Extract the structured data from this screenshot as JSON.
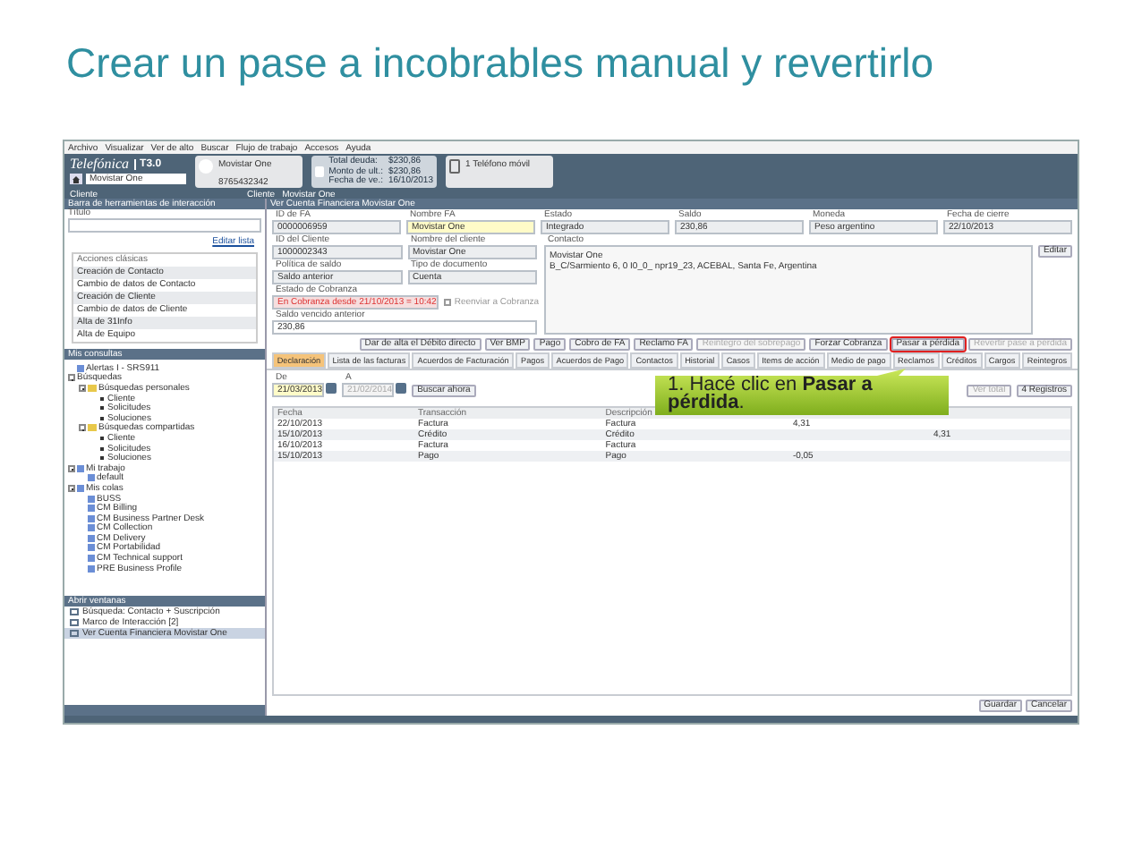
{
  "slide_title": "Crear un pase a incobrables manual y revertirlo",
  "app": {
    "menu": [
      "Archivo",
      "Visualizar",
      "Ver de alto",
      "Buscar",
      "Flujo de trabajo",
      "Accesos",
      "Ayuda"
    ],
    "header": {
      "logo": "Telefónica",
      "version": "T3.0",
      "account_combo": "Movistar One",
      "customer_name": "Movistar One",
      "customer_id": "8765432342",
      "customer_label": "Cliente",
      "totals": [
        {
          "label": "Total deuda:",
          "value": "$230,86"
        },
        {
          "label": "Monto de ult.:",
          "value": "$230,86"
        },
        {
          "label": "Fecha de ve.:",
          "value": "16/10/2013"
        }
      ],
      "phone_card": "1 Teléfono móvil",
      "bottom_label": "Cliente",
      "bottom_value": "Movistar One"
    },
    "toolbar_panel": {
      "title": "Barra de herramientas de interacción",
      "title_label": "Título",
      "edit_link": "Editar lista",
      "items": [
        {
          "label": "Acciones clásicas",
          "kind": "header"
        },
        {
          "label": "Creación de Contacto",
          "kind": "item"
        },
        {
          "label": "Cambio de datos de Contacto",
          "kind": "item"
        },
        {
          "label": "Creación de Cliente",
          "kind": "item"
        },
        {
          "label": "Cambio de datos de Cliente",
          "kind": "item"
        },
        {
          "label": "Alta de 31Info",
          "kind": "item"
        },
        {
          "label": "Alta de Equipo",
          "kind": "item"
        }
      ]
    },
    "queries_panel": {
      "title": "Mis consultas",
      "tree": [
        {
          "label": "Alertas I - SRS911",
          "kind": "query"
        },
        {
          "label": "Búsquedas",
          "kind": "plain",
          "expanded": true,
          "children": [
            {
              "label": "Búsquedas personales",
              "kind": "folder",
              "expanded": true,
              "children": [
                {
                  "label": "Cliente",
                  "kind": "leaf"
                },
                {
                  "label": "Solicitudes",
                  "kind": "leaf"
                },
                {
                  "label": "Soluciones",
                  "kind": "leaf"
                }
              ]
            },
            {
              "label": "Búsquedas compartidas",
              "kind": "folder",
              "expanded": true,
              "children": [
                {
                  "label": "Cliente",
                  "kind": "leaf"
                },
                {
                  "label": "Solicitudes",
                  "kind": "leaf"
                },
                {
                  "label": "Soluciones",
                  "kind": "leaf"
                }
              ]
            }
          ]
        },
        {
          "label": "Mi trabajo",
          "kind": "query",
          "expanded": true,
          "children": [
            {
              "label": "default",
              "kind": "query"
            }
          ]
        },
        {
          "label": "Mis colas",
          "kind": "query",
          "expanded": true,
          "children": [
            {
              "label": "BUSS",
              "kind": "query"
            },
            {
              "label": "CM Billing",
              "kind": "query"
            },
            {
              "label": "CM Business Partner Desk",
              "kind": "query"
            },
            {
              "label": "CM Collection",
              "kind": "query"
            },
            {
              "label": "CM Delivery",
              "kind": "query"
            },
            {
              "label": "CM Portabilidad",
              "kind": "query"
            },
            {
              "label": "CM Technical support",
              "kind": "query"
            },
            {
              "label": "PRE Business Profile",
              "kind": "query"
            }
          ]
        }
      ]
    },
    "windows_panel": {
      "title": "Abrir ventanas",
      "items": [
        {
          "label": "Búsqueda: Contacto + Suscripción",
          "selected": false
        },
        {
          "label": "Marco de Interacción [2]",
          "selected": false
        },
        {
          "label": "Ver Cuenta Financiera Movistar One",
          "selected": true
        }
      ]
    },
    "main": {
      "title": "Ver Cuenta Financiera Movistar One",
      "top_fields": [
        {
          "label": "ID de FA",
          "value": "0000006959",
          "kind": "plain"
        },
        {
          "label": "Nombre FA",
          "value": "Movistar One",
          "kind": "highlight"
        },
        {
          "label": "Estado",
          "value": "Integrado",
          "kind": "plain"
        },
        {
          "label": "Saldo",
          "value": "230,86",
          "kind": "plain"
        },
        {
          "label": "Moneda",
          "value": "Peso argentino",
          "kind": "plain"
        },
        {
          "label": "Fecha de cierre",
          "value": "22/10/2013",
          "kind": "plain"
        }
      ],
      "left_rows": [
        [
          {
            "label": "ID del Cliente",
            "value": "1000002343",
            "kind": "plain"
          },
          {
            "label": "Nombre del cliente",
            "value": "Movistar One",
            "kind": "plain"
          }
        ],
        [
          {
            "label": "Política de saldo",
            "value": "Saldo anterior",
            "kind": "plain"
          },
          {
            "label": "Tipo de documento",
            "value": "Cuenta",
            "kind": "plain"
          }
        ],
        [
          {
            "label": "Estado de Cobranza",
            "value": "En Cobranza desde 21/10/2013 = 10:42",
            "kind": "alert"
          }
        ],
        [
          {
            "label": "Saldo vencido anterior",
            "value": "230,86",
            "kind": "input"
          }
        ]
      ],
      "resend": {
        "label": "Reenviar a Cobranza",
        "checked": false,
        "disabled": true
      },
      "contact": {
        "label": "Contacto",
        "lines": [
          "Movistar One",
          "B_C/Sarmiento 6, 0 I0_0_ npr19_23, ACEBAL, Santa Fe, Argentina"
        ],
        "button": "Editar"
      },
      "actions": [
        {
          "label": "Dar de alta el Débito directo",
          "disabled": false,
          "highlighted": false
        },
        {
          "label": "Ver BMP",
          "disabled": false,
          "highlighted": false
        },
        {
          "label": "Pago",
          "disabled": false,
          "highlighted": false
        },
        {
          "label": "Cobro de FA",
          "disabled": false,
          "highlighted": false
        },
        {
          "label": "Reclamo FA",
          "disabled": false,
          "highlighted": false
        },
        {
          "label": "Reintegro del sobrepago",
          "disabled": true,
          "highlighted": false
        },
        {
          "label": "Forzar Cobranza",
          "disabled": false,
          "highlighted": false
        },
        {
          "label": "Pasar a pérdida",
          "disabled": false,
          "highlighted": true
        },
        {
          "label": "Revertir pase a pérdida",
          "disabled": true,
          "highlighted": false
        }
      ],
      "tabs": [
        {
          "label": "Declaración",
          "selected": true
        },
        {
          "label": "Lista de las facturas",
          "selected": false
        },
        {
          "label": "Acuerdos de Facturación",
          "selected": false
        },
        {
          "label": "Pagos",
          "selected": false
        },
        {
          "label": "Acuerdos de Pago",
          "selected": false
        },
        {
          "label": "Contactos",
          "selected": false
        },
        {
          "label": "Historial",
          "selected": false
        },
        {
          "label": "Casos",
          "selected": false
        },
        {
          "label": "Items de acción",
          "selected": false
        },
        {
          "label": "Medio de pago",
          "selected": false
        },
        {
          "label": "Reclamos",
          "selected": false
        },
        {
          "label": "Créditos",
          "selected": false
        },
        {
          "label": "Cargos",
          "selected": false
        },
        {
          "label": "Reintegros",
          "selected": false
        }
      ],
      "filter": {
        "from_label": "De",
        "from_value": "21/03/2013",
        "from_disabled": false,
        "to_label": "A",
        "to_value": "21/02/2014",
        "to_disabled": true,
        "search_button": "Buscar ahora",
        "total_button": "Ver total",
        "count_button": "4 Registros"
      },
      "table": {
        "columns": [
          "Fecha",
          "Transacción",
          "Descripción"
        ],
        "rows": [
          [
            "22/10/2013",
            "Factura",
            "Factura",
            "4,31",
            ""
          ],
          [
            "15/10/2013",
            "Crédito",
            "Crédito",
            "",
            "4,31"
          ],
          [
            "16/10/2013",
            "Factura",
            "Factura",
            "",
            ""
          ],
          [
            "15/10/2013",
            "Pago",
            "Pago",
            "-0,05",
            ""
          ]
        ]
      },
      "buttons": [
        "Guardar",
        "Cancelar"
      ]
    },
    "callout": "1. Hacé clic en **Pasar a pérdida**."
  }
}
